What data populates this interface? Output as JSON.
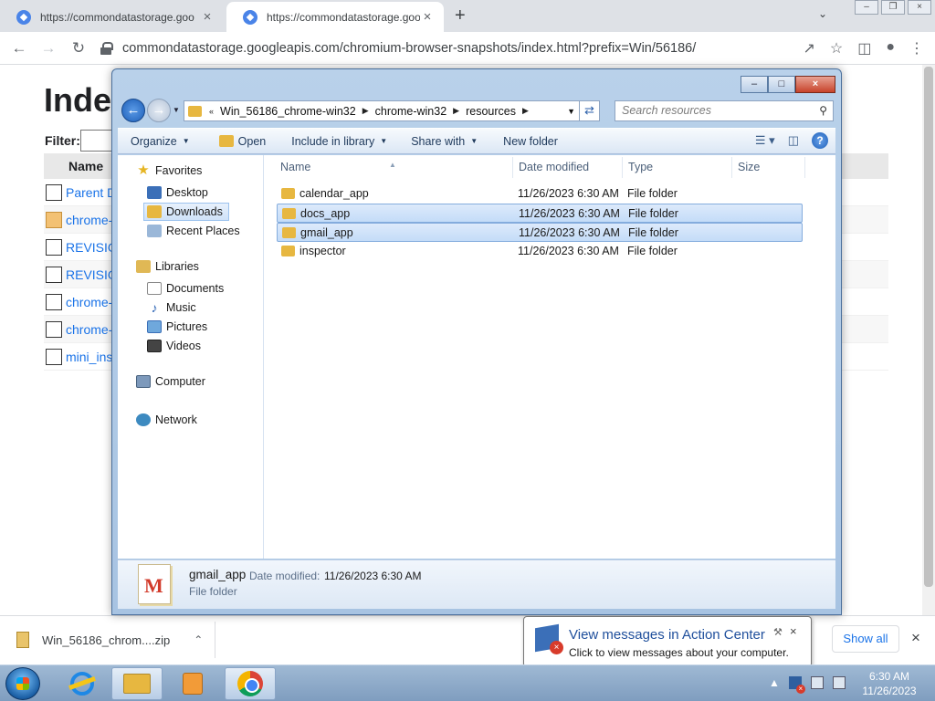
{
  "browser": {
    "tabs": [
      {
        "title": "https://commondatastorage.goo",
        "active": false
      },
      {
        "title": "https://commondatastorage.goo",
        "active": true
      }
    ],
    "url": "commondatastorage.googleapis.com/chromium-browser-snapshots/index.html?prefix=Win/56186/"
  },
  "page": {
    "title": "Index",
    "filter_label": "Filter:",
    "column_name": "Name",
    "entries": [
      "Parent D",
      "chrome-",
      "REVISIO",
      "REVISIO",
      "chrome-",
      "chrome-",
      "mini_ins"
    ]
  },
  "downloads": {
    "file": "Win_56186_chrom....zip",
    "show_all": "Show all"
  },
  "explorer": {
    "breadcrumb": [
      "Win_56186_chrome-win32",
      "chrome-win32",
      "resources"
    ],
    "search_placeholder": "Search resources",
    "commands": {
      "organize": "Organize",
      "open": "Open",
      "include": "Include in library",
      "share": "Share with",
      "new_folder": "New folder"
    },
    "nav": {
      "favorites": "Favorites",
      "desktop": "Desktop",
      "downloads": "Downloads",
      "recent": "Recent Places",
      "libraries": "Libraries",
      "documents": "Documents",
      "music": "Music",
      "pictures": "Pictures",
      "videos": "Videos",
      "computer": "Computer",
      "network": "Network"
    },
    "columns": {
      "name": "Name",
      "date": "Date modified",
      "type": "Type",
      "size": "Size"
    },
    "files": [
      {
        "name": "calendar_app",
        "date": "11/26/2023 6:30 AM",
        "type": "File folder",
        "selected": false
      },
      {
        "name": "docs_app",
        "date": "11/26/2023 6:30 AM",
        "type": "File folder",
        "selected": true
      },
      {
        "name": "gmail_app",
        "date": "11/26/2023 6:30 AM",
        "type": "File folder",
        "selected": true
      },
      {
        "name": "inspector",
        "date": "11/26/2023 6:30 AM",
        "type": "File folder",
        "selected": false
      }
    ],
    "details": {
      "name": "gmail_app",
      "date_label": "Date modified:",
      "date_value": "11/26/2023 6:30 AM",
      "type": "File folder"
    }
  },
  "balloon": {
    "title": "View messages in Action Center",
    "text": "Click to view messages about your computer."
  },
  "clock": {
    "time": "6:30 AM",
    "date": "11/26/2023"
  },
  "colors": {
    "selection": "#cce4fa",
    "link": "#1a73e8",
    "taskbar": "#8fabc9"
  }
}
